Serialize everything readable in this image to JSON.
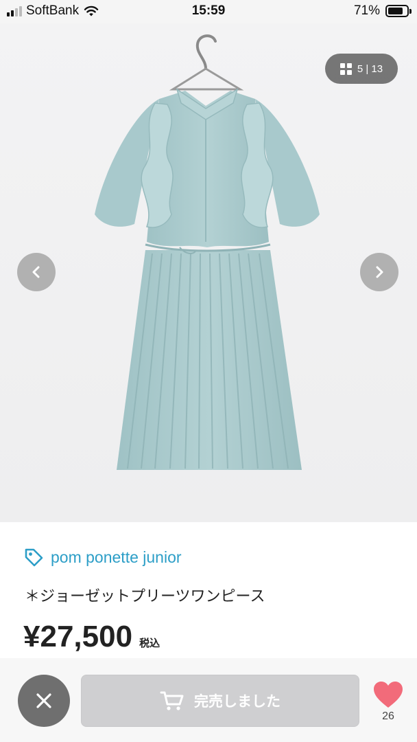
{
  "status_bar": {
    "carrier": "SoftBank",
    "time": "15:59",
    "battery": "71%"
  },
  "gallery": {
    "counter": "5 | 13",
    "image_alt": "light blue pleated dress with ruffles on hanger"
  },
  "product": {
    "brand": "pom ponette junior",
    "title": "＊ジョーゼットプリーツワンピース",
    "price": "¥27,500",
    "tax_label": "税込"
  },
  "bottom_bar": {
    "sold_label": "完売しました",
    "like_count": "26"
  },
  "icons": {
    "signal": "signal-icon",
    "wifi": "wifi-icon",
    "battery": "battery-icon",
    "grid": "grid-icon",
    "prev": "chevron-left-icon",
    "next": "chevron-right-icon",
    "tag": "tag-icon",
    "close": "close-icon",
    "cart": "cart-icon",
    "heart": "heart-icon"
  },
  "colors": {
    "brand": "#2c9ec7",
    "heart": "#f26b7a",
    "sold_button": "#cfcfd1",
    "dress": "#a9c9cc"
  }
}
